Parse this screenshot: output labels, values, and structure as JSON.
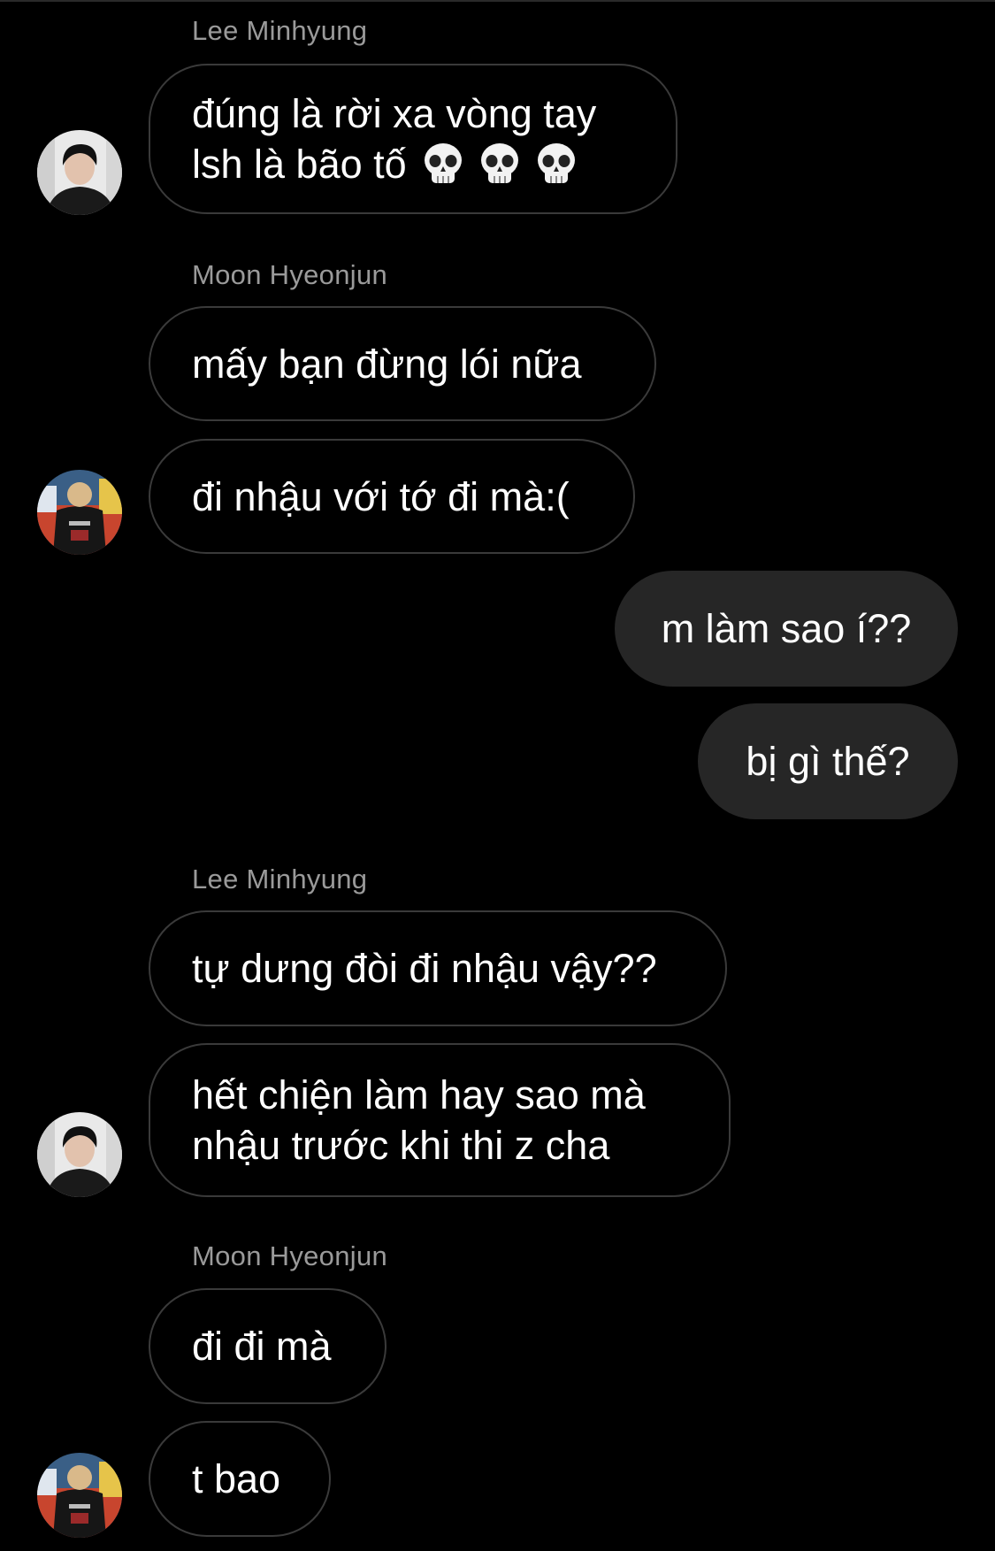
{
  "messages": [
    {
      "sender": "Lee Minhyung",
      "lines": [
        "đúng là rời xa vòng tay",
        "lsh là bão tố"
      ],
      "emoji": "skull-emoji"
    },
    {
      "sender": "Moon Hyeonjun",
      "text": "mấy bạn đừng lói nữa"
    },
    {
      "text": "đi nhậu với tớ đi mà:("
    },
    {
      "text": "m làm sao í??"
    },
    {
      "text": "bị gì thế?"
    },
    {
      "sender": "Lee Minhyung",
      "text": "tự dưng đòi đi nhậu vậy??"
    },
    {
      "lines": [
        "hết chiện làm hay sao mà",
        "nhậu trước khi thi z cha"
      ]
    },
    {
      "sender": "Moon Hyeonjun",
      "text": "đi đi mà"
    },
    {
      "text": "t bao"
    }
  ],
  "colors": {
    "background": "#000000",
    "incoming_border": "#3a3a3a",
    "outgoing_bubble": "#262626",
    "sender_name": "#9a9a9a",
    "text": "#ffffff"
  }
}
